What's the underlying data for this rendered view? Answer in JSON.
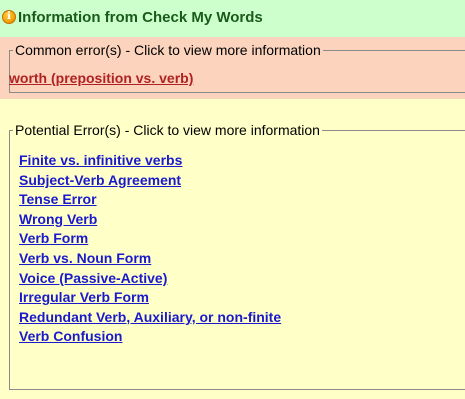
{
  "header": {
    "title": "Information from Check My Words",
    "icon": "info-icon"
  },
  "common_errors": {
    "legend": "Common error(s) - Click to view more information",
    "items": [
      {
        "label": "worth (preposition vs. verb)"
      }
    ]
  },
  "potential_errors": {
    "legend": "Potential Error(s) -  Click to view more information",
    "items": [
      {
        "label": "Finite vs. infinitive verbs"
      },
      {
        "label": "Subject-Verb Agreement"
      },
      {
        "label": "Tense Error"
      },
      {
        "label": "Wrong Verb"
      },
      {
        "label": "Verb Form"
      },
      {
        "label": "Verb vs. Noun Form"
      },
      {
        "label": "Voice (Passive-Active)"
      },
      {
        "label": "Irregular Verb Form"
      },
      {
        "label": "Redundant Verb, Auxiliary, or non-finite"
      },
      {
        "label": "Verb Confusion"
      }
    ]
  },
  "colors": {
    "header_bg": "#ccffcc",
    "header_text": "#1a5a1a",
    "common_bg": "#fcd4bd",
    "common_link": "#b02222",
    "potential_bg": "#ffffc8",
    "potential_link": "#1a1acc"
  }
}
